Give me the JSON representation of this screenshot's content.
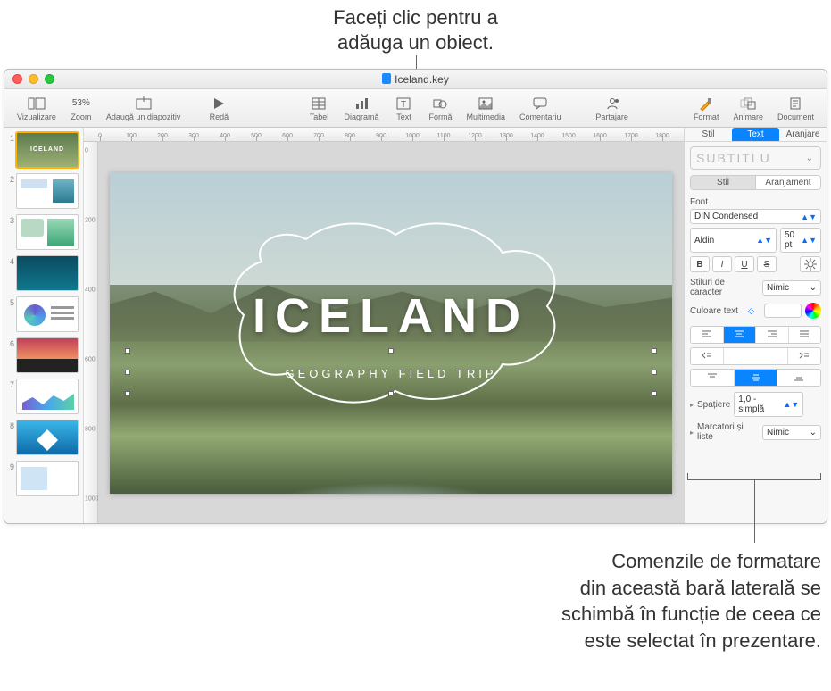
{
  "callouts": {
    "top": "Faceți clic pentru a\nadăuga un obiect.",
    "bottom": "Comenzile de formatare\ndin această bară laterală se\nschimbă în funcție de ceea ce\neste selectat în prezentare."
  },
  "window": {
    "title": "Iceland.key"
  },
  "toolbar": {
    "vizualizare": "Vizualizare",
    "zoom_value": "53%",
    "zoom": "Zoom",
    "add_slide": "Adaugă un diapozitiv",
    "play": "Redă",
    "tabel": "Tabel",
    "diagrama": "Diagramă",
    "text": "Text",
    "forma": "Formă",
    "multimedia": "Multimedia",
    "comentariu": "Comentariu",
    "partajare": "Partajare",
    "format": "Format",
    "animare": "Animare",
    "document": "Document"
  },
  "slides": {
    "thumb1_label": "ICELAND",
    "nums": [
      "1",
      "2",
      "3",
      "4",
      "5",
      "6",
      "7",
      "8",
      "9"
    ]
  },
  "ruler_h": [
    "0",
    "100",
    "200",
    "300",
    "400",
    "500",
    "600",
    "700",
    "800",
    "900",
    "1000",
    "1100",
    "1200",
    "1300",
    "1400",
    "1500",
    "1600",
    "1700",
    "1800"
  ],
  "ruler_v": [
    "0",
    "200",
    "400",
    "600",
    "800",
    "1000"
  ],
  "slide": {
    "title": "ICELAND",
    "subtitle": "GEOGRAPHY FIELD TRIP"
  },
  "inspector": {
    "tabs": {
      "stil": "Stil",
      "text": "Text",
      "aranjare": "Aranjare"
    },
    "paragraph_style": "SUBTITLU",
    "seg": {
      "stil": "Stil",
      "aranjament": "Aranjament"
    },
    "font_label": "Font",
    "font_family": "DIN Condensed",
    "font_weight": "Aldin",
    "font_size": "50 pt",
    "char_styles_label": "Stiluri de caracter",
    "char_styles_value": "Nimic",
    "text_color_label": "Culoare text",
    "spacing_label": "Spațiere",
    "spacing_value": "1,0 - simplă",
    "bullets_label": "Marcatori și liste",
    "bullets_value": "Nimic"
  }
}
